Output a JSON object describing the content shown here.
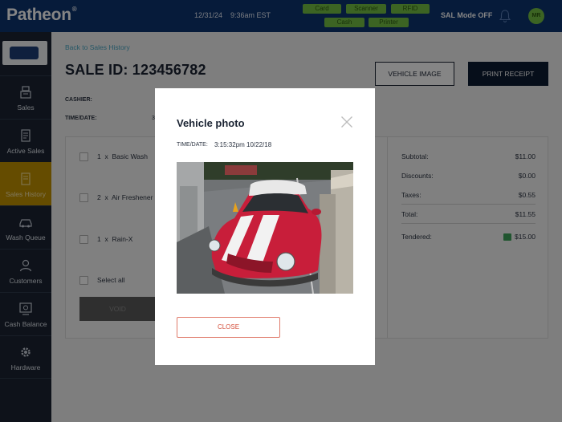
{
  "topbar": {
    "brand": "Patheon",
    "brand_mark": "®",
    "date": "12/31/24",
    "time": "9:36am EST",
    "pills": [
      "Card",
      "Scanner",
      "RFID",
      "Cash",
      "Printer"
    ],
    "sal_mode": "SAL Mode OFF",
    "avatar_initials": "MR",
    "accent_color": "#74c043",
    "bar_color": "#0d3470"
  },
  "sidebar": {
    "active_color": "#c19200",
    "items": [
      {
        "label": "Sales",
        "icon": "register-icon"
      },
      {
        "label": "Active Sales",
        "icon": "receipt-icon"
      },
      {
        "label": "Sales History",
        "icon": "history-icon"
      },
      {
        "label": "Wash Queue",
        "icon": "car-icon"
      },
      {
        "label": "Customers",
        "icon": "person-icon"
      },
      {
        "label": "Cash Balance",
        "icon": "cash-icon"
      },
      {
        "label": "Hardware",
        "icon": "gear-icon"
      }
    ]
  },
  "main": {
    "back_link": "Back to Sales History",
    "sale_title": "SALE ID: 123456782",
    "vehicle_image_button": "VEHICLE IMAGE",
    "print_receipt_button": "PRINT RECEIPT",
    "cashier_label": "CASHIER:",
    "time_date_label": "TIME/DATE:",
    "time_date_partial": "3",
    "items": [
      {
        "qty": "1",
        "name": "Basic Wash"
      },
      {
        "qty": "2",
        "name": "Air Freshener"
      },
      {
        "qty": "1",
        "name": "Rain-X"
      }
    ],
    "select_all": "Select all",
    "void_button": "VOID"
  },
  "summary": {
    "subtotal_label": "Subtotal:",
    "subtotal": "$11.00",
    "discounts_label": "Discounts:",
    "discounts": "$0.00",
    "taxes_label": "Taxes:",
    "taxes": "$0.55",
    "total_label": "Total:",
    "total": "$11.55",
    "tendered_label": "Tendered:",
    "tendered": "$15.00"
  },
  "modal": {
    "title": "Vehicle photo",
    "time_label": "TIME/DATE:",
    "time_value": "3:15:32pm  10/22/18",
    "close_button": "CLOSE",
    "close_color": "#d4503c"
  }
}
